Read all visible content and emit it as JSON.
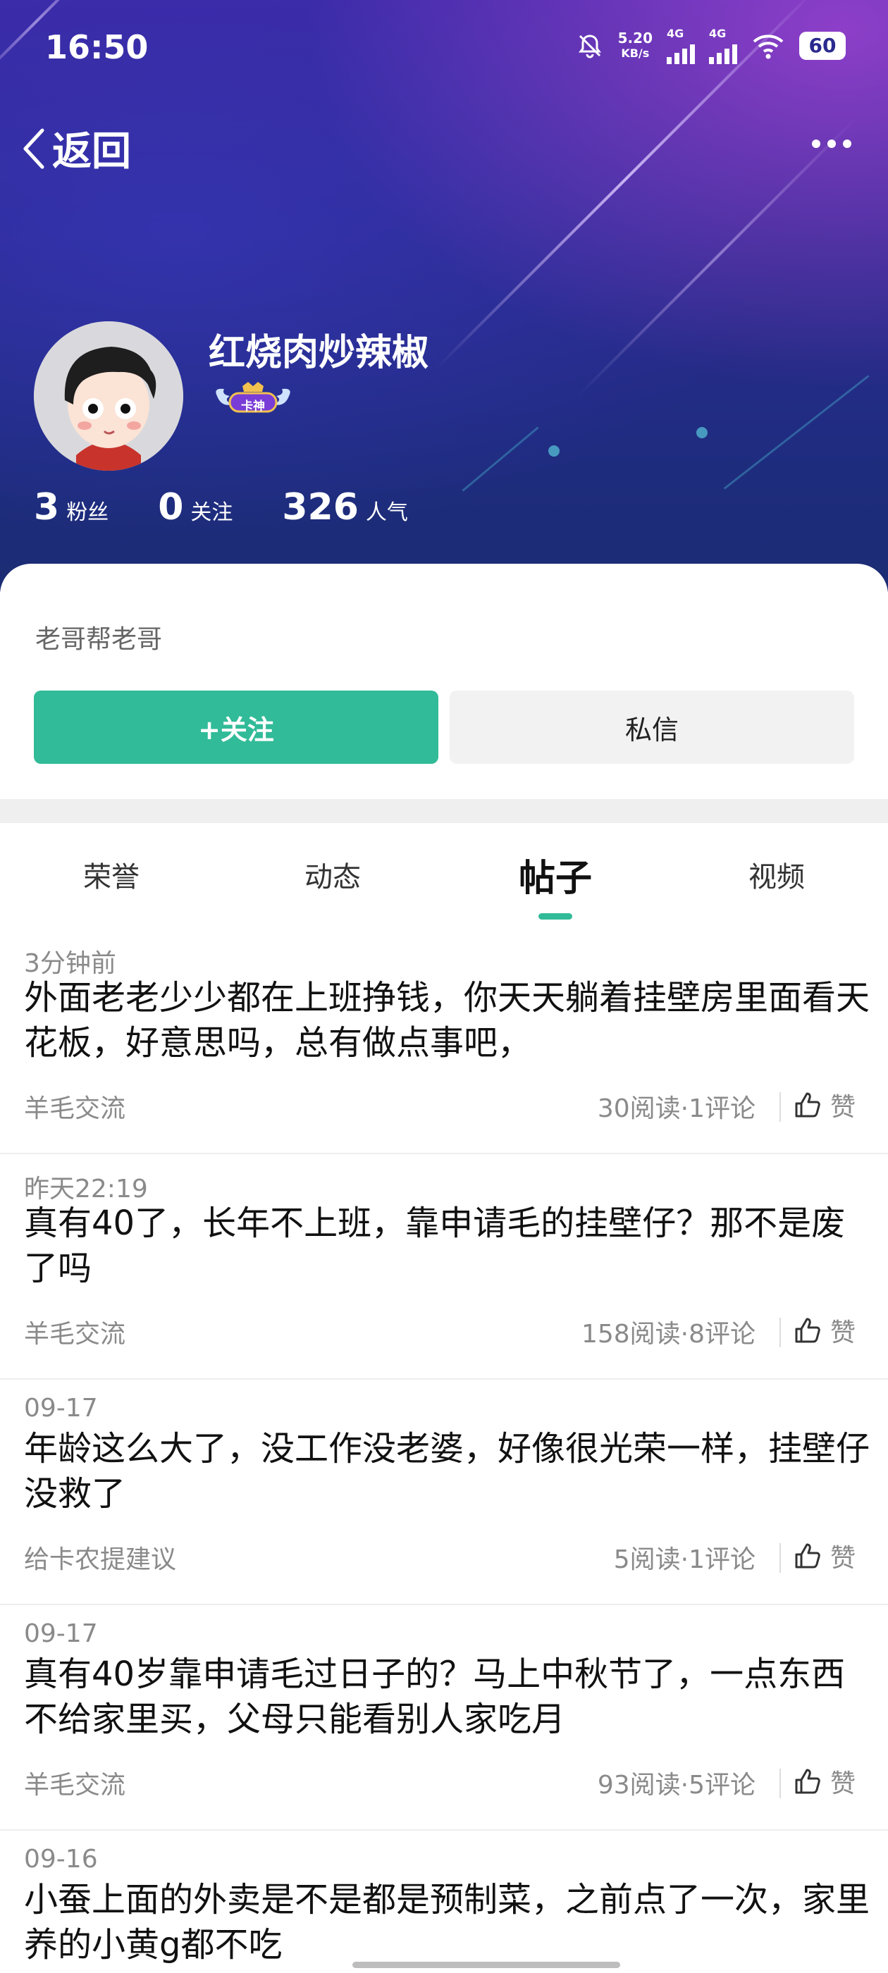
{
  "status_bar": {
    "time": "16:50",
    "net_speed_value": "5.20",
    "net_speed_unit": "KB/s",
    "signal1_label": "4G",
    "signal2_label": "4G",
    "battery": "60",
    "icons": [
      "mute-bell-icon",
      "signal-icon",
      "signal-icon",
      "wifi-icon",
      "battery-icon"
    ]
  },
  "nav": {
    "back_label": "返回",
    "more_icon": "more-horizontal-icon"
  },
  "profile": {
    "name": "红烧肉炒辣椒",
    "badge_label": "卡神",
    "stats": [
      {
        "value": "3",
        "label": "粉丝"
      },
      {
        "value": "0",
        "label": "关注"
      },
      {
        "value": "326",
        "label": "人气"
      }
    ],
    "bio": "老哥帮老哥",
    "follow_label": "+关注",
    "message_label": "私信"
  },
  "tabs": [
    {
      "label": "荣誉"
    },
    {
      "label": "动态"
    },
    {
      "label": "帖子"
    },
    {
      "label": "视频"
    }
  ],
  "active_tab": "帖子",
  "like_label": "赞",
  "colors": {
    "accent": "#31bb98",
    "hero_top": "#3b2aa6",
    "hero_bottom": "#1b2c73"
  },
  "posts": [
    {
      "time": "3分钟前",
      "title": "外面老老少少都在上班挣钱，你天天躺着挂壁房里面看天花板，好意思吗，总有做点事吧，",
      "category": "羊毛交流",
      "stats": "30阅读·1评论"
    },
    {
      "time": "昨天22:19",
      "title": "真有40了，长年不上班，靠申请毛的挂壁仔？那不是废了吗",
      "category": "羊毛交流",
      "stats": "158阅读·8评论"
    },
    {
      "time": "09-17",
      "title": "年龄这么大了，没工作没老婆，好像很光荣一样，挂壁仔没救了",
      "category": "给卡农提建议",
      "stats": "5阅读·1评论"
    },
    {
      "time": "09-17",
      "title": "真有40岁靠申请毛过日子的？马上中秋节了，一点东西不给家里买，父母只能看别人家吃月",
      "category": "羊毛交流",
      "stats": "93阅读·5评论"
    },
    {
      "time": "09-16",
      "title": "小蚕上面的外卖是不是都是预制菜，之前点了一次，家里养的小黄g都不吃",
      "category": "",
      "stats": ""
    }
  ]
}
